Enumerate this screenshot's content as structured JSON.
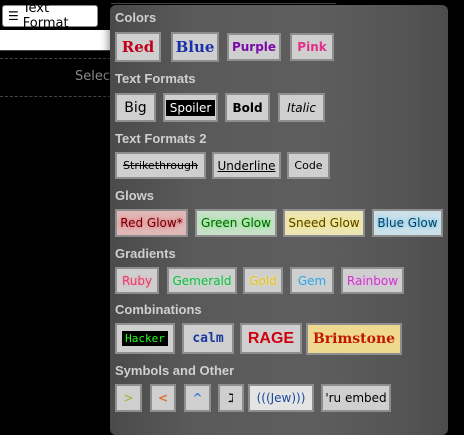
{
  "app": {
    "menu_button_label": "Text Format",
    "select_placeholder": "Selec"
  },
  "panel": {
    "sections": {
      "colors": "Colors",
      "text_formats": "Text Formats",
      "text_formats_2": "Text Formats 2",
      "glows": "Glows",
      "gradients": "Gradients",
      "combinations": "Combinations",
      "symbols": "Symbols and Other"
    },
    "colors": {
      "red": "Red",
      "blue": "Blue",
      "purple": "Purple",
      "pink": "Pink"
    },
    "text_formats": {
      "big": "Big",
      "spoiler": "Spoiler",
      "bold": "Bold",
      "italic": "Italic"
    },
    "text_formats_2": {
      "strikethrough": "Strikethrough",
      "underline": "Underline",
      "code": "Code"
    },
    "glows": {
      "red": "Red Glow*",
      "green": "Green Glow",
      "sneed": "Sneed Glow",
      "blue": "Blue Glow"
    },
    "gradients": {
      "ruby": "Ruby",
      "gemerald": "Gemerald",
      "gold": "Gold",
      "gem": "Gem",
      "rainbow": "Rainbow"
    },
    "combinations": {
      "hacker": "Hacker",
      "calm": "calm",
      "rage": "RAGE",
      "brimstone": "Brimstone"
    },
    "symbols": {
      "greentext": ">",
      "orangetext": "<",
      "caret": "^",
      "hebrew": "ℷ",
      "echoes": "(((Jew)))",
      "ru_embed": "'ru embed"
    }
  },
  "colors_meta": {
    "red": "#c0001a",
    "blue": "#1a2fa8",
    "purple": "#7a0aa8",
    "pink": "#e0308a"
  }
}
